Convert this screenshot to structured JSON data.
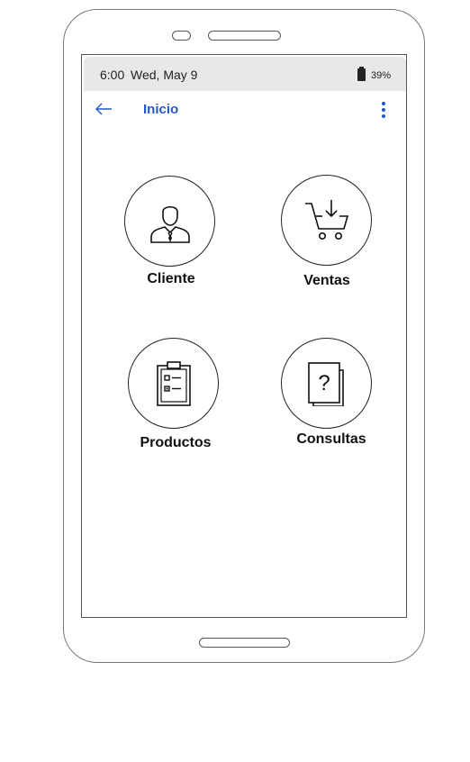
{
  "status_bar": {
    "time": "6:00",
    "date": "Wed, May 9",
    "battery": "39%"
  },
  "app_bar": {
    "title": "Inicio",
    "accent_color": "#2458c6"
  },
  "menu": {
    "items": [
      {
        "label": "Cliente",
        "icon": "user-icon"
      },
      {
        "label": "Ventas",
        "icon": "cart-download-icon"
      },
      {
        "label": "Productos",
        "icon": "clipboard-checklist-icon"
      },
      {
        "label": "Consultas",
        "icon": "question-document-icon"
      }
    ]
  }
}
